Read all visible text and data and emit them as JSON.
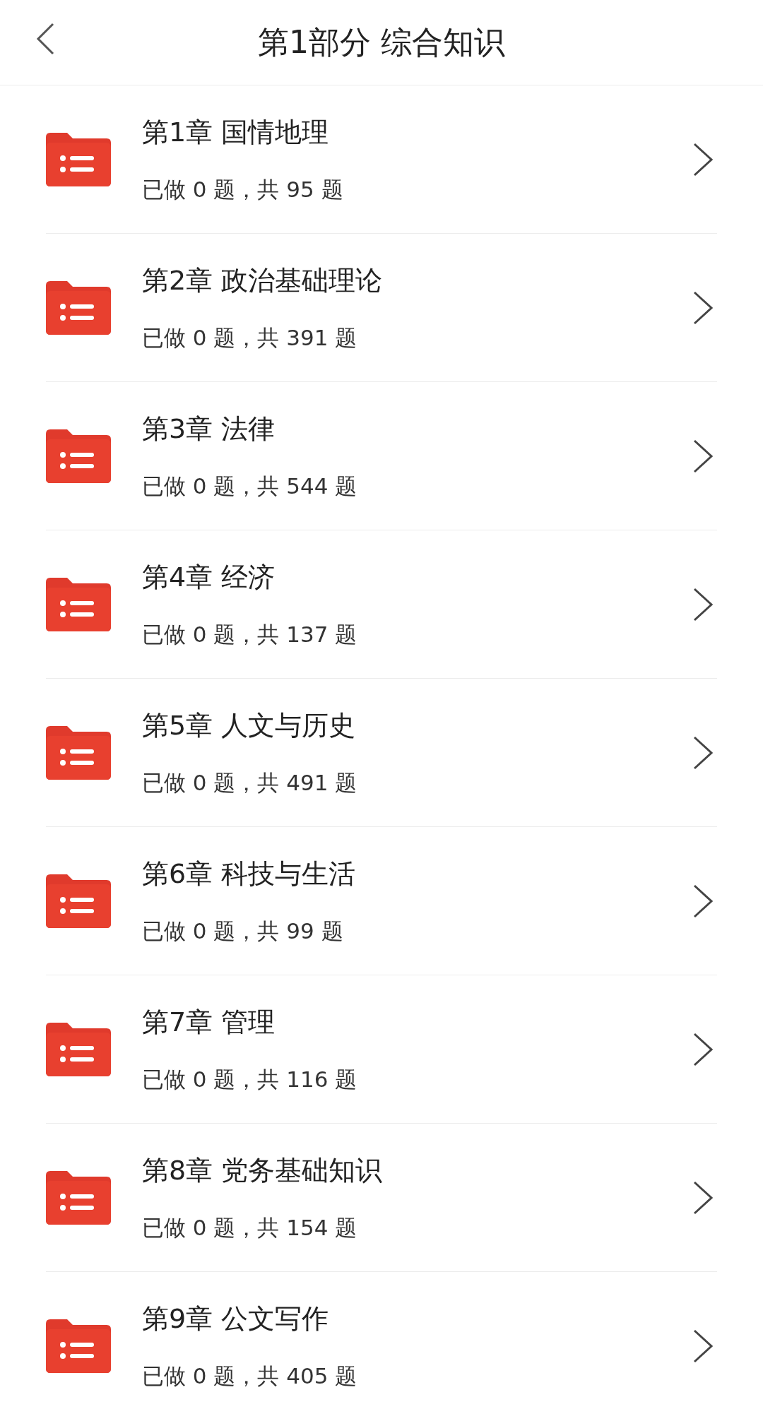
{
  "header": {
    "title": "第1部分 综合知识"
  },
  "chapters": [
    {
      "title": "第1章 国情地理",
      "progress": "已做 0 题，共 95 题"
    },
    {
      "title": "第2章 政治基础理论",
      "progress": "已做 0 题，共 391 题"
    },
    {
      "title": "第3章 法律",
      "progress": "已做 0 题，共 544 题"
    },
    {
      "title": "第4章 经济",
      "progress": "已做 0 题，共 137 题"
    },
    {
      "title": "第5章 人文与历史",
      "progress": "已做 0 题，共 491 题"
    },
    {
      "title": "第6章 科技与生活",
      "progress": "已做 0 题，共 99 题"
    },
    {
      "title": "第7章 管理",
      "progress": "已做 0 题，共 116 题"
    },
    {
      "title": "第8章 党务基础知识",
      "progress": "已做 0 题，共 154 题"
    },
    {
      "title": "第9章 公文写作",
      "progress": "已做 0 题，共 405 题"
    }
  ]
}
